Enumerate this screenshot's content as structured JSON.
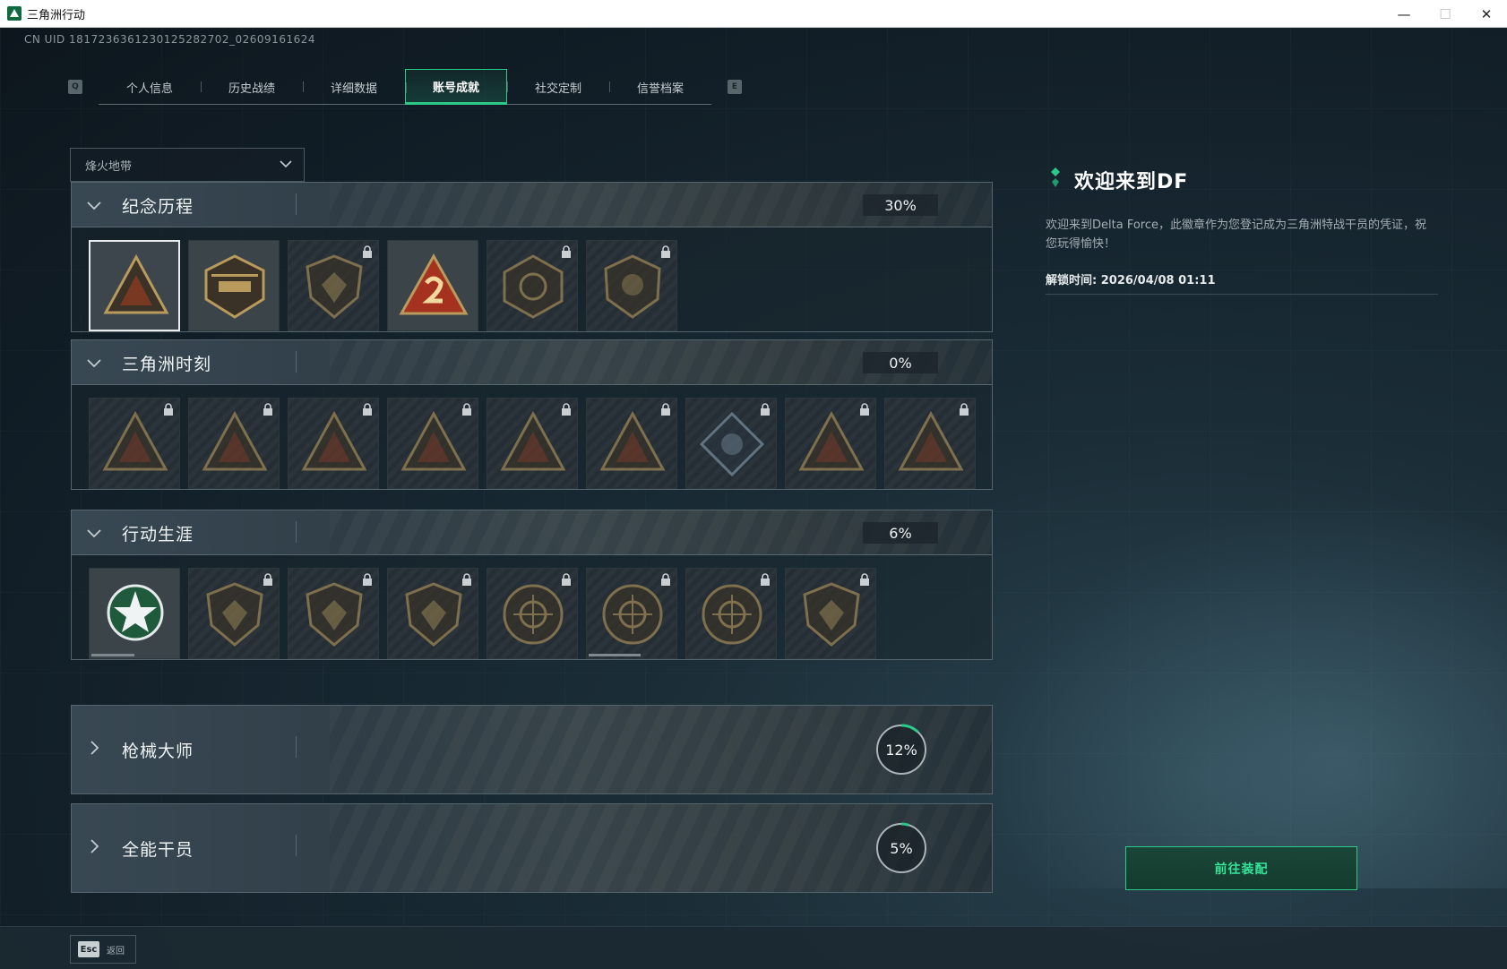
{
  "window": {
    "title": "三角洲行动",
    "controls": {
      "minimize": "—",
      "maximize": "☐",
      "close": "✕"
    }
  },
  "uid_text": "CN UID 1817236361230125282702_02609161624",
  "tabs": {
    "prev_key": "Q",
    "next_key": "E",
    "items": [
      {
        "label": "个人信息",
        "active": false
      },
      {
        "label": "历史战绩",
        "active": false
      },
      {
        "label": "详细数据",
        "active": false
      },
      {
        "label": "账号成就",
        "active": true
      },
      {
        "label": "社交定制",
        "active": false
      },
      {
        "label": "信誉档案",
        "active": false
      }
    ]
  },
  "mode_select": {
    "value": "烽火地带"
  },
  "sections": [
    {
      "title": "纪念历程",
      "percent": "30%",
      "expanded": true,
      "badges": [
        {
          "icon": "triangle-emblem-icon",
          "locked": false,
          "selected": true
        },
        {
          "icon": "helicopter-emblem-icon",
          "locked": false
        },
        {
          "icon": "shield-emblem-icon",
          "locked": true
        },
        {
          "icon": "number-two-emblem-icon",
          "locked": false
        },
        {
          "icon": "hexagon-emblem-icon",
          "locked": true
        },
        {
          "icon": "crest-emblem-icon",
          "locked": true
        }
      ]
    },
    {
      "title": "三角洲时刻",
      "percent": "0%",
      "expanded": true,
      "badges": [
        {
          "icon": "triangle-emblem-icon",
          "locked": true
        },
        {
          "icon": "triangle-emblem-icon",
          "locked": true
        },
        {
          "icon": "triangle-emblem-icon",
          "locked": true
        },
        {
          "icon": "triangle-emblem-icon",
          "locked": true
        },
        {
          "icon": "triangle-emblem-icon",
          "locked": true
        },
        {
          "icon": "triangle-emblem-icon",
          "locked": true
        },
        {
          "icon": "diamond-emblem-icon",
          "locked": true
        },
        {
          "icon": "triangle-emblem-icon",
          "locked": true
        },
        {
          "icon": "triangle-emblem-icon",
          "locked": true
        }
      ]
    },
    {
      "title": "行动生涯",
      "percent": "6%",
      "expanded": true,
      "badges": [
        {
          "icon": "star-emblem-icon",
          "locked": false,
          "progress": 0.5
        },
        {
          "icon": "shield-emblem-icon",
          "locked": true
        },
        {
          "icon": "shield-emblem-icon",
          "locked": true
        },
        {
          "icon": "shield-emblem-icon",
          "locked": true
        },
        {
          "icon": "round-emblem-icon",
          "locked": true
        },
        {
          "icon": "round-emblem-icon",
          "locked": true,
          "progress": 0.6
        },
        {
          "icon": "round-emblem-icon",
          "locked": true
        },
        {
          "icon": "shield-emblem-icon",
          "locked": true
        }
      ]
    },
    {
      "title": "枪械大师",
      "percent": "12%",
      "progress": 0.12,
      "expanded": false
    },
    {
      "title": "全能干员",
      "percent": "5%",
      "progress": 0.05,
      "expanded": false
    }
  ],
  "info": {
    "title": "欢迎来到DF",
    "description": "欢迎来到Delta Force，此徽章作为您登记成为三角洲特战干员的凭证，祝您玩得愉快！",
    "unlock_time": "解锁时间: 2026/04/08 01:11"
  },
  "equip_button": "前往装配",
  "back": {
    "key": "Esc",
    "label": "返回"
  },
  "colors": {
    "accent": "#2cc989",
    "panel": "#1a262e"
  }
}
